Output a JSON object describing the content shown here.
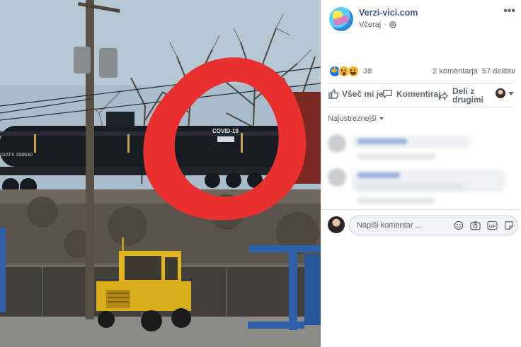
{
  "post": {
    "page_name": "Verzi-vici.com",
    "timestamp": "Včeraj",
    "dot": "·",
    "photo_label": "COVID-19",
    "tank_marking": "GATX 206630"
  },
  "reactions": {
    "count": "38",
    "comments": "2 komentarja",
    "shares": "57 delitev"
  },
  "actions": {
    "like": "Všeč mi je",
    "comment": "Komentiraj",
    "share": "Deli z drugimi"
  },
  "comments": {
    "sort_label": "Najustreznejši"
  },
  "composer": {
    "placeholder": "Napiši komentar ..."
  },
  "colors": {
    "link": "#385898",
    "like_blue": "#1877f2",
    "circle_red": "#e8312f"
  }
}
